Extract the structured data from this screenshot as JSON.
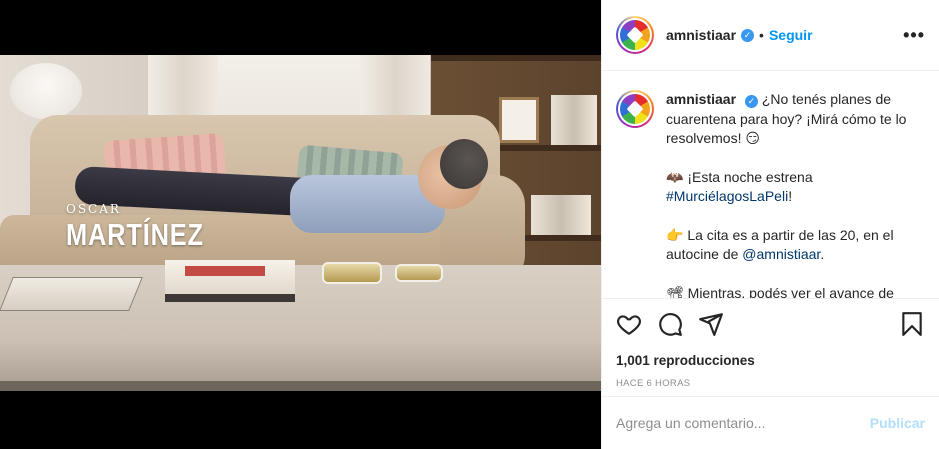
{
  "post": {
    "username": "amnistiaar",
    "follow_label": "Seguir",
    "more_label": "•••",
    "credit": {
      "first_name": "OSCAR",
      "last_name": "MARTÍNEZ"
    },
    "caption": {
      "line1": "¿No tenés planes de cuarentena para hoy? ¡Mirá cómo te lo resolvemos! 😏",
      "line2_prefix": "🦇 ¡Esta noche estrena ",
      "line2_hashtag": "#MurciélagosLaPeli",
      "line2_suffix": "!",
      "line3_prefix": "👉 La cita es a partir de las 20, en el autocine de ",
      "line3_mention": "@amnistiaar",
      "line3_suffix": ".",
      "line4": "📽 Mientras, podés ver el avance de"
    },
    "views": "1,001 reproducciones",
    "time": "HACE 6 HORAS",
    "comment_placeholder": "Agrega un comentario...",
    "publish_label": "Publicar"
  },
  "icons": [
    "heart-icon",
    "comment-icon",
    "share-icon",
    "bookmark-icon",
    "verified-icon",
    "more-icon"
  ],
  "colors": {
    "link": "#00376b",
    "follow": "#0095f6",
    "publish_disabled": "#b2dffc",
    "muted": "#8e8e8e"
  }
}
